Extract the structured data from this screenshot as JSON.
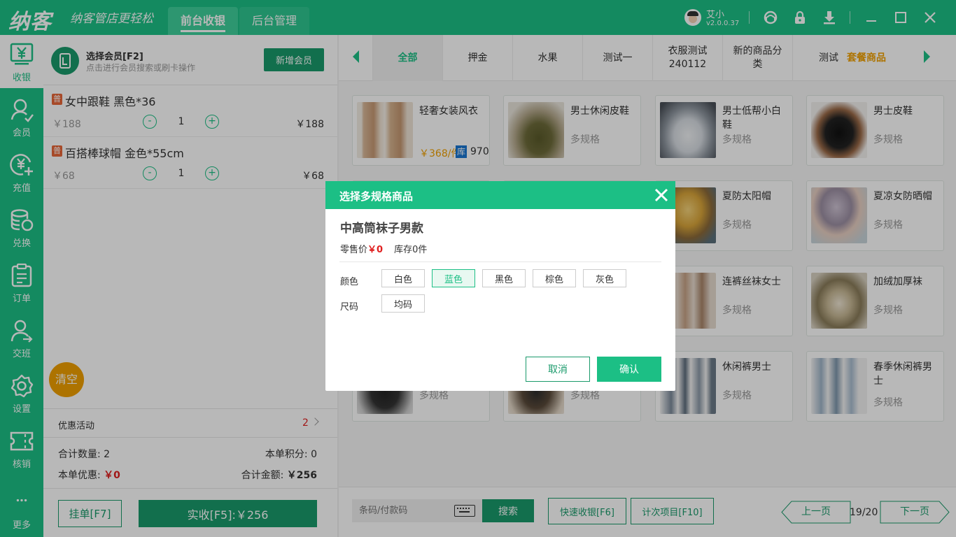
{
  "app": {
    "logo": "纳客",
    "slogan": "纳客管店更轻松",
    "version": "v2.0.0.37",
    "user": "艾小"
  },
  "nav": {
    "tabs": [
      {
        "label": "前台收银"
      },
      {
        "label": "后台管理"
      }
    ]
  },
  "sidebar": {
    "items": [
      {
        "label": "收银",
        "icon": "yen-icon"
      },
      {
        "label": "会员",
        "icon": "member-icon"
      },
      {
        "label": "充值",
        "icon": "recharge-icon"
      },
      {
        "label": "兑换",
        "icon": "exchange-icon"
      },
      {
        "label": "订单",
        "icon": "order-icon"
      },
      {
        "label": "交班",
        "icon": "shift-icon"
      },
      {
        "label": "设置",
        "icon": "gear-icon"
      },
      {
        "label": "核销",
        "icon": "ticket-icon"
      },
      {
        "label": "更多",
        "icon": "more-icon"
      }
    ]
  },
  "member": {
    "title": "选择会员[F2]",
    "subtitle": "点击进行会员搜索或刷卡操作",
    "new_button": "新增会员"
  },
  "cart": {
    "items": [
      {
        "badge": "普",
        "name": "女中跟鞋 黑色*36",
        "price": "￥188",
        "qty": "1",
        "total": "￥188"
      },
      {
        "badge": "普",
        "name": "百搭棒球帽 金色*55cm",
        "price": "￥68",
        "qty": "1",
        "total": "￥68"
      }
    ],
    "clear_label": "清空",
    "minus": "-",
    "plus": "+"
  },
  "promo": {
    "label": "优惠活动",
    "count": "2"
  },
  "summary": {
    "count_label": "合计数量:",
    "count": "2",
    "points_label": "本单积分:",
    "points": "0",
    "discount_label": "本单优惠:",
    "discount": "￥0",
    "total_label": "合计金额:",
    "total": "￥256"
  },
  "actions": {
    "hang": "挂单[F7]",
    "pay": "实收[F5]:￥256"
  },
  "categories": [
    {
      "label": "全部"
    },
    {
      "label": "押金"
    },
    {
      "label": "水果"
    },
    {
      "label": "测试一"
    },
    {
      "label": "衣服测试240112"
    },
    {
      "label": "新的商品分类"
    },
    {
      "label": "测试",
      "extra": "套餐商品"
    }
  ],
  "products": [
    {
      "name": "轻奢女装风衣",
      "price": "￥368/件",
      "stock_badge": "库",
      "stock": "970"
    },
    {
      "name": "男士休闲皮鞋",
      "spec": "多规格"
    },
    {
      "name": "男士低帮小白鞋",
      "spec": "多规格"
    },
    {
      "name": "男士皮鞋",
      "spec": "多规格"
    },
    {
      "name": "夏防太阳帽",
      "spec": "多规格"
    },
    {
      "name": "夏凉女防晒帽",
      "spec": "多规格"
    },
    {
      "name": "连裤丝袜女士",
      "spec": "多规格"
    },
    {
      "name": "加绒加厚袜",
      "spec": "多规格"
    },
    {
      "spec": "多规格"
    },
    {
      "spec": "多规格"
    },
    {
      "name": "休闲裤男士",
      "spec": "多规格"
    },
    {
      "name": "春季休闲裤男士",
      "spec": "多规格"
    }
  ],
  "bottom": {
    "scan_placeholder": "条码/付款码",
    "search": "搜索",
    "quick": "快速收银[F6]",
    "count_items": "计次项目[F10]",
    "prev": "上一页",
    "page": "19/20",
    "next": "下一页"
  },
  "modal": {
    "title": "选择多规格商品",
    "product": "中高筒袜子男款",
    "price_label": "零售价",
    "price": "￥0",
    "stock": "库存0件",
    "color_label": "颜色",
    "colors": [
      "白色",
      "蓝色",
      "黑色",
      "棕色",
      "灰色"
    ],
    "selected_color": "蓝色",
    "size_label": "尺码",
    "sizes": [
      "均码"
    ],
    "cancel": "取消",
    "confirm": "确认"
  },
  "colors": {
    "brand": "#1cbf85",
    "dark": "#1a9a6b",
    "accent": "#f0a000",
    "red": "#e02020"
  }
}
